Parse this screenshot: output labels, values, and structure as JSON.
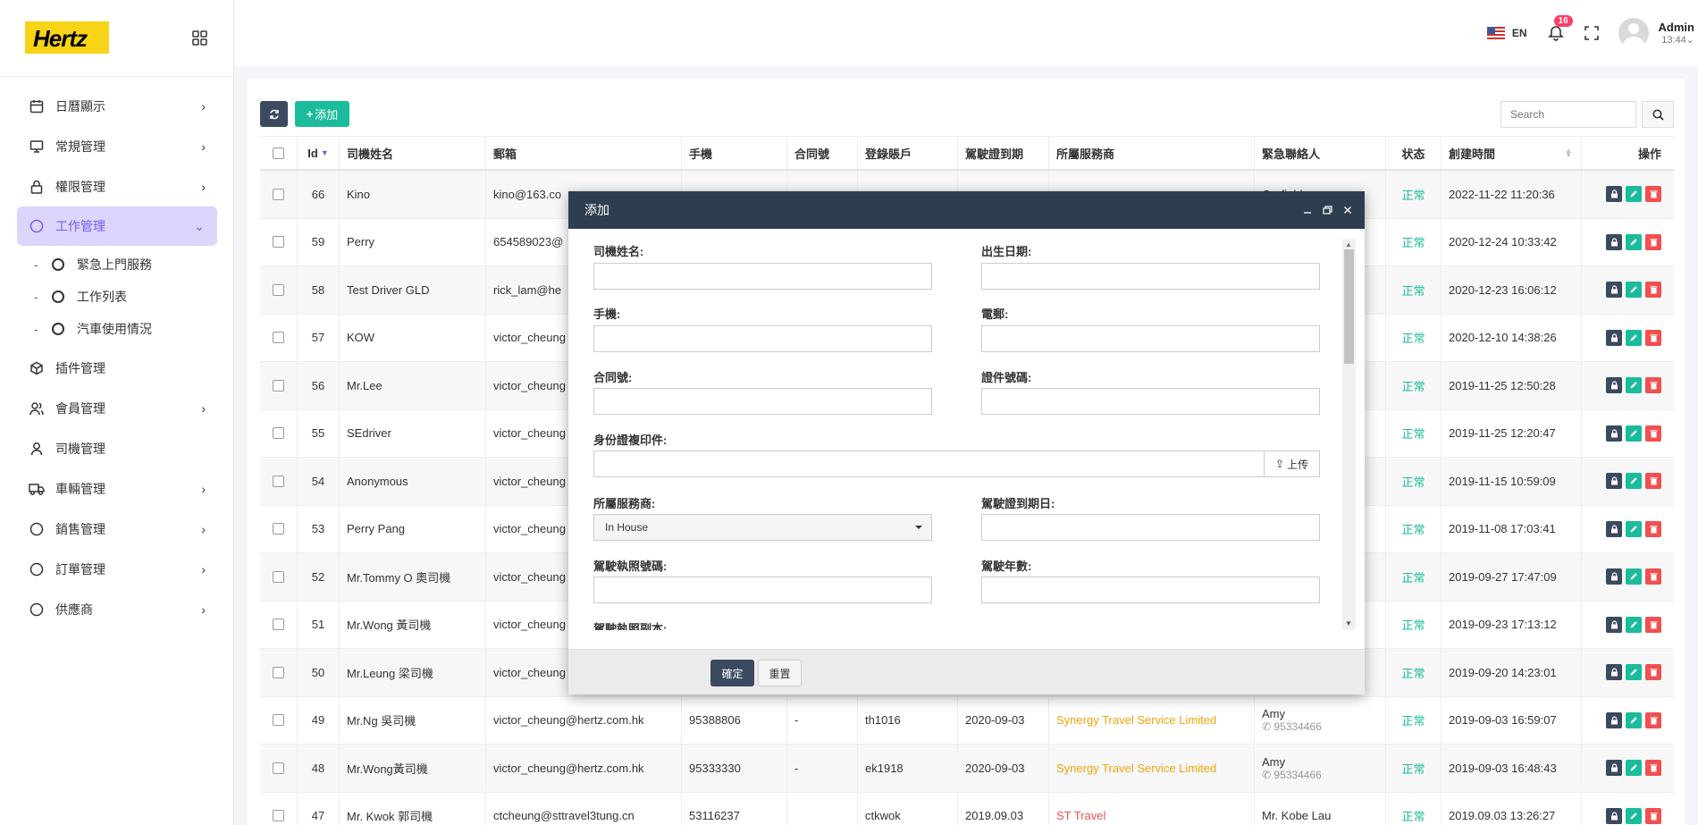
{
  "brand": {
    "logo_text": "Hertz",
    "color": "#f7d417"
  },
  "topbar": {
    "lang": "EN",
    "notif_count": "16",
    "user_name": "Admin",
    "user_time": "13:44"
  },
  "sidebar": {
    "items": [
      {
        "label": "日曆顯示",
        "icon": "calendar-icon"
      },
      {
        "label": "常規管理",
        "icon": "monitor-icon"
      },
      {
        "label": "權限管理",
        "icon": "lock-icon"
      },
      {
        "label": "工作管理",
        "icon": "circle-icon"
      },
      {
        "label": "插件管理",
        "icon": "cube-icon"
      },
      {
        "label": "會員管理",
        "icon": "users-icon"
      },
      {
        "label": "司機管理",
        "icon": "user-icon"
      },
      {
        "label": "車輛管理",
        "icon": "truck-icon"
      },
      {
        "label": "銷售管理",
        "icon": "circle-icon"
      },
      {
        "label": "訂單管理",
        "icon": "circle-icon"
      },
      {
        "label": "供應商",
        "icon": "circle-icon"
      }
    ],
    "sub_items": [
      {
        "label": "緊急上門服務"
      },
      {
        "label": "工作列表"
      },
      {
        "label": "汽車使用情況"
      }
    ]
  },
  "toolbar": {
    "add_label": "添加",
    "search_placeholder": "Search"
  },
  "table": {
    "headers": [
      "Id",
      "司機姓名",
      "郵箱",
      "手機",
      "合同號",
      "登錄賬戶",
      "駕駛證到期",
      "所屬服務商",
      "緊急聯絡人",
      "状态",
      "創建時間",
      "操作"
    ],
    "rows": [
      {
        "id": "66",
        "name": "Kino",
        "email": "kino@163.co",
        "phone": "",
        "contract": "",
        "account": "",
        "expiry": "",
        "provider": "",
        "contact": "Garfield",
        "contact_phone": "",
        "status": "正常",
        "created": "2022-11-22 11:20:36"
      },
      {
        "id": "59",
        "name": "Perry",
        "email": "654589023@",
        "phone": "",
        "contract": "",
        "account": "",
        "expiry": "",
        "provider": "",
        "contact": "",
        "contact_phone": "",
        "status": "正常",
        "created": "2020-12-24 10:33:42"
      },
      {
        "id": "58",
        "name": "Test Driver GLD",
        "email": "rick_lam@he",
        "phone": "",
        "contract": "",
        "account": "",
        "expiry": "",
        "provider": "",
        "contact": "",
        "contact_phone": "",
        "status": "正常",
        "created": "2020-12-23 16:06:12"
      },
      {
        "id": "57",
        "name": "KOW",
        "email": "victor_cheung",
        "phone": "",
        "contract": "",
        "account": "",
        "expiry": "",
        "provider": "",
        "contact": "",
        "contact_phone": "",
        "status": "正常",
        "created": "2020-12-10 14:38:26"
      },
      {
        "id": "56",
        "name": "Mr.Lee",
        "email": "victor_cheung",
        "phone": "",
        "contract": "",
        "account": "",
        "expiry": "",
        "provider": "",
        "contact": "",
        "contact_phone": "",
        "status": "正常",
        "created": "2019-11-25 12:50:28"
      },
      {
        "id": "55",
        "name": "SEdriver",
        "email": "victor_cheung",
        "phone": "",
        "contract": "",
        "account": "",
        "expiry": "",
        "provider": "",
        "contact": "",
        "contact_phone": "",
        "status": "正常",
        "created": "2019-11-25 12:20:47"
      },
      {
        "id": "54",
        "name": "Anonymous",
        "email": "victor_cheung",
        "phone": "",
        "contract": "",
        "account": "",
        "expiry": "",
        "provider": "",
        "contact": "",
        "contact_phone": "",
        "status": "正常",
        "created": "2019-11-15 10:59:09"
      },
      {
        "id": "53",
        "name": "Perry Pang",
        "email": "victor_cheung",
        "phone": "",
        "contract": "",
        "account": "",
        "expiry": "",
        "provider": "",
        "contact": "",
        "contact_phone": "",
        "status": "正常",
        "created": "2019-11-08 17:03:41"
      },
      {
        "id": "52",
        "name": "Mr.Tommy O 奧司機",
        "email": "victor_cheung",
        "phone": "",
        "contract": "",
        "account": "",
        "expiry": "",
        "provider": "",
        "contact": "",
        "contact_phone": "",
        "status": "正常",
        "created": "2019-09-27 17:47:09"
      },
      {
        "id": "51",
        "name": "Mr.Wong 黃司機",
        "email": "victor_cheung",
        "phone": "",
        "contract": "",
        "account": "",
        "expiry": "",
        "provider": "",
        "contact": "",
        "contact_phone": "",
        "status": "正常",
        "created": "2019-09-23 17:13:12"
      },
      {
        "id": "50",
        "name": "Mr.Leung 梁司機",
        "email": "victor_cheung",
        "phone": "",
        "contract": "",
        "account": "",
        "expiry": "",
        "provider": "",
        "contact": "",
        "contact_phone": "",
        "status": "正常",
        "created": "2019-09-20 14:23:01"
      },
      {
        "id": "49",
        "name": "Mr.Ng 吳司機",
        "email": "victor_cheung@hertz.com.hk",
        "phone": "95388806",
        "contract": "-",
        "account": "th1016",
        "expiry": "2020-09-03",
        "provider": "Synergy Travel Service Limited",
        "contact": "Amy",
        "contact_phone": "95334466",
        "status": "正常",
        "created": "2019-09-03 16:59:07"
      },
      {
        "id": "48",
        "name": "Mr.Wong黃司機",
        "email": "victor_cheung@hertz.com.hk",
        "phone": "95333330",
        "contract": "-",
        "account": "ek1918",
        "expiry": "2020-09-03",
        "provider": "Synergy Travel Service Limited",
        "contact": "Amy",
        "contact_phone": "95334466",
        "status": "正常",
        "created": "2019-09-03 16:48:43"
      },
      {
        "id": "47",
        "name": "Mr. Kwok 郭司機",
        "email": "ctcheung@sttravel3tung.cn",
        "phone": "53116237",
        "contract": "",
        "account": "ctkwok",
        "expiry": "2019.09.03",
        "provider": "ST Travel",
        "contact": "Mr. Kobe Lau",
        "contact_phone": "",
        "status": "正常",
        "created": "2019.09.03 13:26:27"
      }
    ]
  },
  "modal": {
    "title": "添加",
    "fields": {
      "name": "司機姓名:",
      "dob": "出生日期:",
      "phone": "手機:",
      "email": "電郵:",
      "contract": "合同號:",
      "id_number": "證件號碼:",
      "id_copy": "身份證複印件:",
      "provider": "所屬服務商:",
      "provider_value": "In House",
      "license_expiry": "駕駛證到期日:",
      "license_no": "駕駛執照號碼:",
      "driving_years": "駕駛年數:",
      "license_copy": "駕駛執照副本:"
    },
    "upload_label": "上传",
    "ok_label": "確定",
    "reset_label": "重置"
  },
  "colors": {
    "accent": "#7a5af5",
    "green": "#1bbc9b",
    "dark": "#3b4a5f",
    "red": "#f05050",
    "orange": "#f0a30a"
  }
}
